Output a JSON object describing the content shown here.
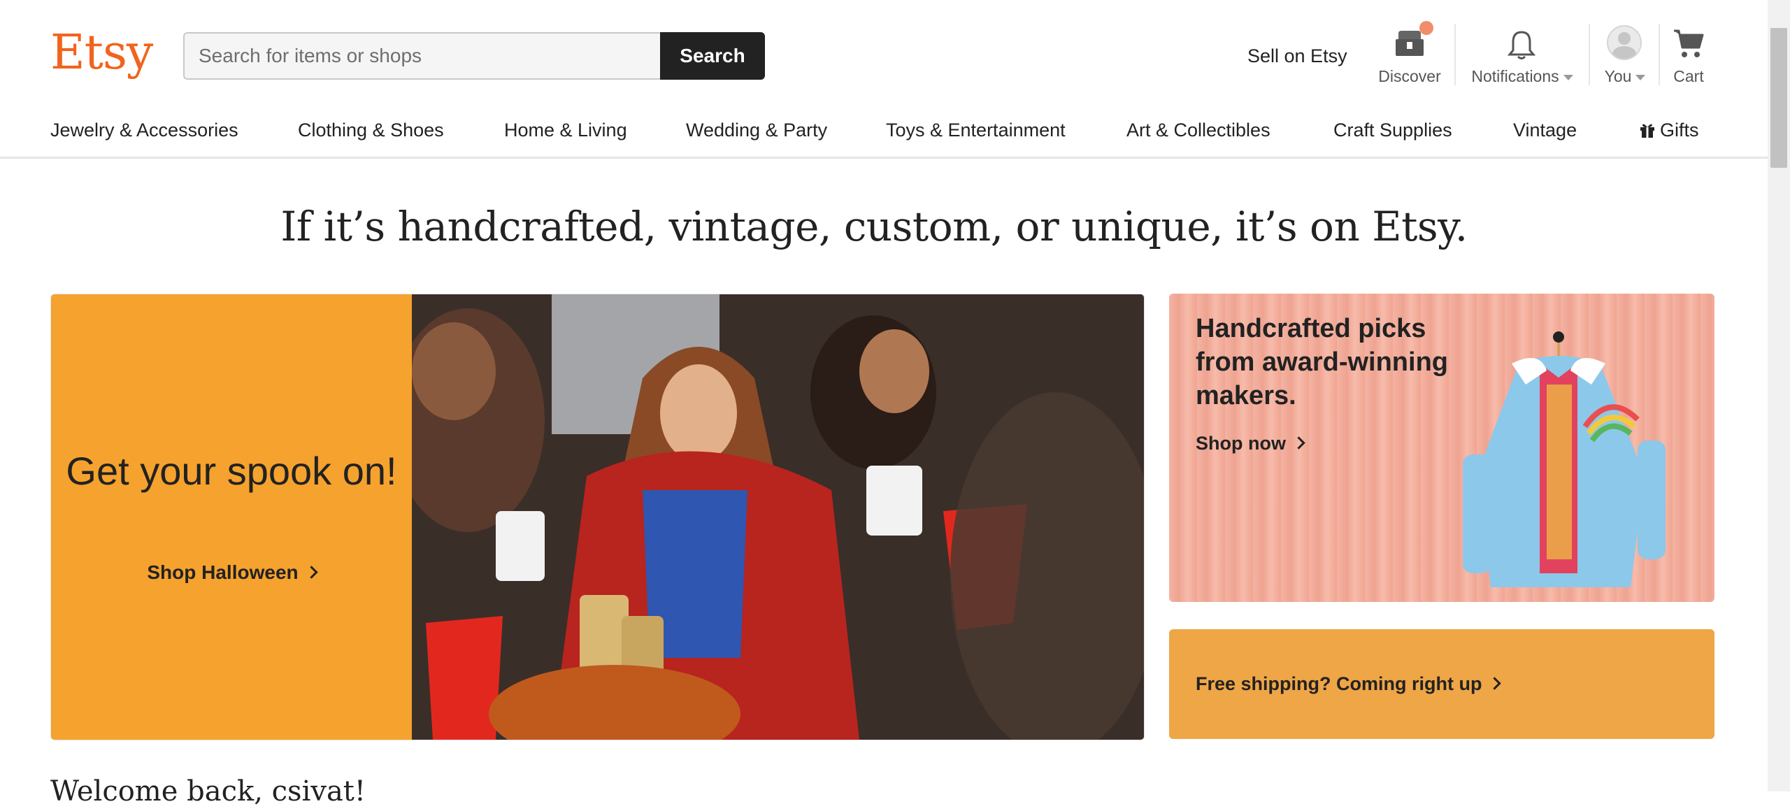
{
  "header": {
    "logo": "Etsy",
    "search": {
      "placeholder": "Search for items or shops",
      "button_label": "Search"
    },
    "sell_link": "Sell on Etsy",
    "icons": [
      {
        "name": "discover",
        "label": "Discover"
      },
      {
        "name": "notifications",
        "label": "Notifications"
      },
      {
        "name": "you",
        "label": "You"
      },
      {
        "name": "cart",
        "label": "Cart"
      }
    ]
  },
  "categories": [
    "Jewelry & Accessories",
    "Clothing & Shoes",
    "Home & Living",
    "Wedding & Party",
    "Toys & Entertainment",
    "Art & Collectibles",
    "Craft Supplies",
    "Vintage",
    "Gifts"
  ],
  "headline": "If it’s handcrafted, vintage, custom, or unique, it’s on Etsy.",
  "hero": {
    "title": "Get your spook on!",
    "link": "Shop Halloween",
    "color": "#F6A22E"
  },
  "cards": [
    {
      "title": "Handcrafted picks from award-winning makers.",
      "link": "Shop now"
    },
    {
      "link": "Free shipping? Coming right up",
      "color": "#EFA646"
    }
  ],
  "welcome": "Welcome back, csivat!",
  "colors": {
    "brand": "#F1641E",
    "dark": "#222222"
  }
}
